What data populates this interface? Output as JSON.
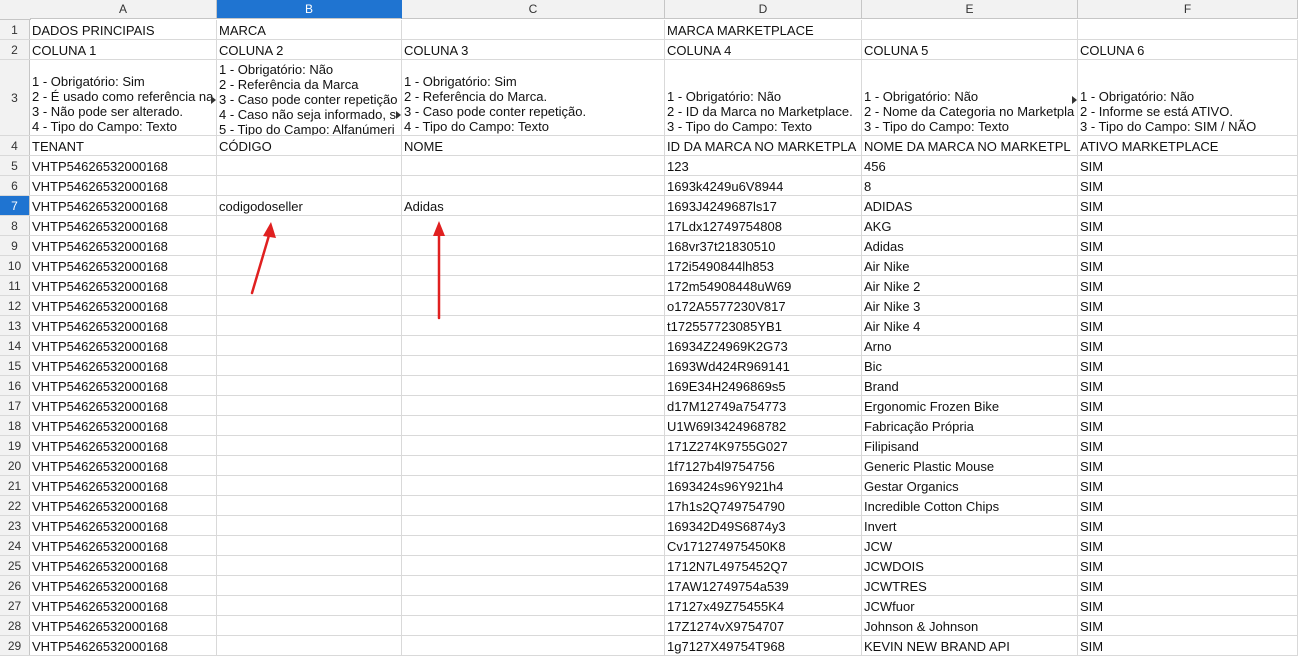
{
  "columns": [
    "A",
    "B",
    "C",
    "D",
    "E",
    "F"
  ],
  "rows": [
    {
      "n": "1",
      "a": "DADOS PRINCIPAIS",
      "b": "MARCA",
      "c": "",
      "d": "MARCA MARKETPLACE",
      "e": "",
      "f": ""
    },
    {
      "n": "2",
      "a": "COLUNA 1",
      "b": "COLUNA 2",
      "c": "COLUNA 3",
      "d": "COLUNA 4",
      "e": "COLUNA 5",
      "f": "COLUNA 6"
    },
    {
      "n": "3",
      "a": "1 - Obrigatório: Sim\n2 - É usado como referência na\n3 - Não pode ser alterado.\n4 - Tipo do Campo: Texto",
      "b": "1 - Obrigatório: Não\n2 - Referência da Marca\n3 - Caso pode conter repetição\n4 - Caso não seja informado, s\n5 - Tipo do Campo: Alfanúmeri",
      "c": "1 - Obrigatório: Sim\n2 - Referência do Marca.\n3 - Caso pode conter repetição.\n4 - Tipo do Campo: Texto",
      "d": "1 - Obrigatório: Não\n2 - ID da Marca no Marketplace.\n3 - Tipo do Campo: Texto",
      "e": "1 - Obrigatório: Não\n2 - Nome da Categoria no Marketpla\n3 - Tipo do Campo: Texto",
      "f": "1 - Obrigatório: Não\n2 - Informe se está ATIVO.\n3 - Tipo do Campo: SIM / NÃO"
    },
    {
      "n": "4",
      "a": "TENANT",
      "b": "CÓDIGO",
      "c": "NOME",
      "d": "ID DA MARCA NO MARKETPLA",
      "e": "NOME DA MARCA NO MARKETPL",
      "f": "ATIVO MARKETPLACE"
    },
    {
      "n": "5",
      "a": "VHTP54626532000168",
      "b": "",
      "c": "",
      "d": "123",
      "e": "456",
      "f": "SIM"
    },
    {
      "n": "6",
      "a": "VHTP54626532000168",
      "b": "",
      "c": "",
      "d": "1693k4249u6V8944",
      "e": "8",
      "f": "SIM"
    },
    {
      "n": "7",
      "a": "VHTP54626532000168",
      "b": "codigodoseller",
      "c": "Adidas",
      "d": "1693J4249687ls17",
      "e": "ADIDAS",
      "f": "SIM"
    },
    {
      "n": "8",
      "a": "VHTP54626532000168",
      "b": "",
      "c": "",
      "d": "17Ldx12749754808",
      "e": "AKG",
      "f": "SIM"
    },
    {
      "n": "9",
      "a": "VHTP54626532000168",
      "b": "",
      "c": "",
      "d": "168vr37t21830510",
      "e": "Adidas",
      "f": "SIM"
    },
    {
      "n": "10",
      "a": "VHTP54626532000168",
      "b": "",
      "c": "",
      "d": "172i5490844lh853",
      "e": "Air Nike",
      "f": "SIM"
    },
    {
      "n": "11",
      "a": "VHTP54626532000168",
      "b": "",
      "c": "",
      "d": "172m54908448uW69",
      "e": "Air Nike 2",
      "f": "SIM"
    },
    {
      "n": "12",
      "a": "VHTP54626532000168",
      "b": "",
      "c": "",
      "d": "o172A5577230V817",
      "e": "Air Nike 3",
      "f": "SIM"
    },
    {
      "n": "13",
      "a": "VHTP54626532000168",
      "b": "",
      "c": "",
      "d": "t172557723085YB1",
      "e": "Air Nike 4",
      "f": "SIM"
    },
    {
      "n": "14",
      "a": "VHTP54626532000168",
      "b": "",
      "c": "",
      "d": "16934Z24969K2G73",
      "e": "Arno",
      "f": "SIM"
    },
    {
      "n": "15",
      "a": "VHTP54626532000168",
      "b": "",
      "c": "",
      "d": "1693Wd424R969141",
      "e": "Bic",
      "f": "SIM"
    },
    {
      "n": "16",
      "a": "VHTP54626532000168",
      "b": "",
      "c": "",
      "d": "169E34H2496869s5",
      "e": "Brand",
      "f": "SIM"
    },
    {
      "n": "17",
      "a": "VHTP54626532000168",
      "b": "",
      "c": "",
      "d": "d17M12749a754773",
      "e": "Ergonomic Frozen Bike",
      "f": "SIM"
    },
    {
      "n": "18",
      "a": "VHTP54626532000168",
      "b": "",
      "c": "",
      "d": "U1W69I3424968782",
      "e": "Fabricação Própria",
      "f": "SIM"
    },
    {
      "n": "19",
      "a": "VHTP54626532000168",
      "b": "",
      "c": "",
      "d": "171Z274K9755G027",
      "e": "Filipisand",
      "f": "SIM"
    },
    {
      "n": "20",
      "a": "VHTP54626532000168",
      "b": "",
      "c": "",
      "d": "1f7127b4l9754756",
      "e": "Generic Plastic Mouse",
      "f": "SIM"
    },
    {
      "n": "21",
      "a": "VHTP54626532000168",
      "b": "",
      "c": "",
      "d": "1693424s96Y921h4",
      "e": "Gestar Organics",
      "f": "SIM"
    },
    {
      "n": "22",
      "a": "VHTP54626532000168",
      "b": "",
      "c": "",
      "d": "17h1s2Q749754790",
      "e": "Incredible Cotton Chips",
      "f": "SIM"
    },
    {
      "n": "23",
      "a": "VHTP54626532000168",
      "b": "",
      "c": "",
      "d": "169342D49S6874y3",
      "e": "Invert",
      "f": "SIM"
    },
    {
      "n": "24",
      "a": "VHTP54626532000168",
      "b": "",
      "c": "",
      "d": "Cv171274975450K8",
      "e": "JCW",
      "f": "SIM"
    },
    {
      "n": "25",
      "a": "VHTP54626532000168",
      "b": "",
      "c": "",
      "d": "1712N7L4975452Q7",
      "e": "JCWDOIS",
      "f": "SIM"
    },
    {
      "n": "26",
      "a": "VHTP54626532000168",
      "b": "",
      "c": "",
      "d": "17AW12749754a539",
      "e": "JCWTRES",
      "f": "SIM"
    },
    {
      "n": "27",
      "a": "VHTP54626532000168",
      "b": "",
      "c": "",
      "d": "17127x49Z75455K4",
      "e": "JCWfuor",
      "f": "SIM"
    },
    {
      "n": "28",
      "a": "VHTP54626532000168",
      "b": "",
      "c": "",
      "d": "17Z1274vX9754707",
      "e": "Johnson & Johnson",
      "f": "SIM"
    },
    {
      "n": "29",
      "a": "VHTP54626532000168",
      "b": "",
      "c": "",
      "d": "1g7127X49754T968",
      "e": "KEVIN NEW BRAND API",
      "f": "SIM"
    }
  ],
  "selection": {
    "active_column": "B",
    "active_row": "7"
  },
  "colors": {
    "header_bg": "#f2f2f2",
    "active": "#1f74d1",
    "annotation_arrow": "#e02020",
    "gridline": "#d9d9d9"
  }
}
